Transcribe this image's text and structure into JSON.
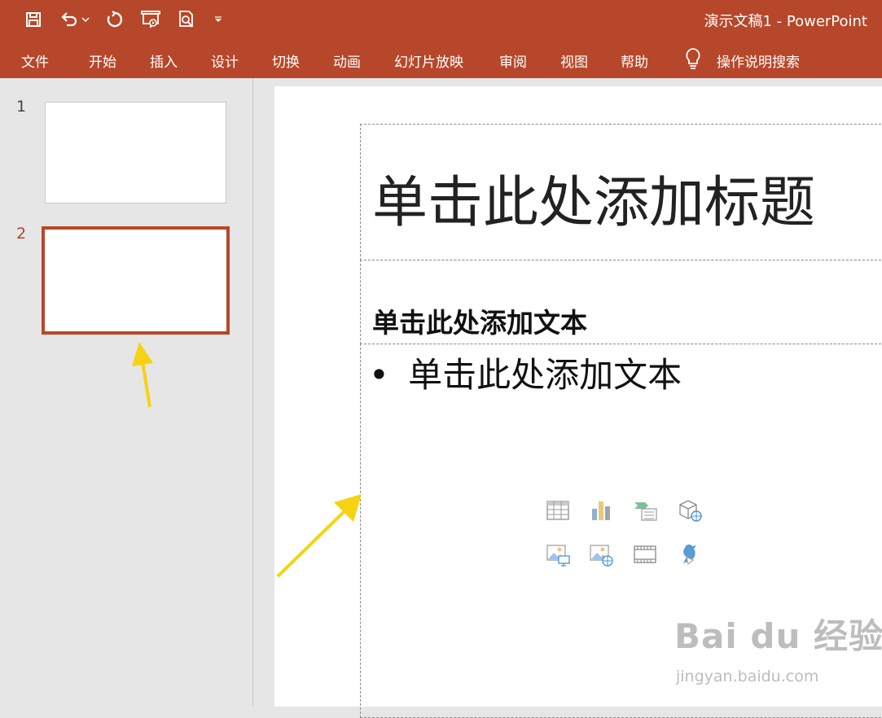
{
  "app": {
    "title": "演示文稿1  -  PowerPoint",
    "accent_color": "#b7472a"
  },
  "qat": {
    "icons": [
      "save-icon",
      "undo-icon",
      "dropdown-arrow-icon",
      "redo-icon",
      "present-from-beginning-icon",
      "print-preview-icon",
      "customize-qat-icon"
    ]
  },
  "ribbon": {
    "tabs": [
      "文件",
      "开始",
      "插入",
      "设计",
      "切换",
      "动画",
      "幻灯片放映",
      "审阅",
      "视图",
      "帮助"
    ],
    "tell_me": "操作说明搜索"
  },
  "thumbnails": {
    "items": [
      {
        "number": "1",
        "selected": false
      },
      {
        "number": "2",
        "selected": true
      }
    ]
  },
  "slide": {
    "title_placeholder": "单击此处添加标题",
    "heading_placeholder": "单击此处添加文本",
    "bullet_placeholder": "单击此处添加文本",
    "bullet_char": "•",
    "insert_icons": [
      "insert-table-icon",
      "insert-chart-icon",
      "insert-smartart-icon",
      "insert-3d-model-icon",
      "insert-picture-icon",
      "insert-online-picture-icon",
      "insert-video-icon",
      "insert-icons-icon"
    ]
  },
  "watermark": {
    "main": "Bai du 经验",
    "sub": "jingyan.baidu.com"
  }
}
